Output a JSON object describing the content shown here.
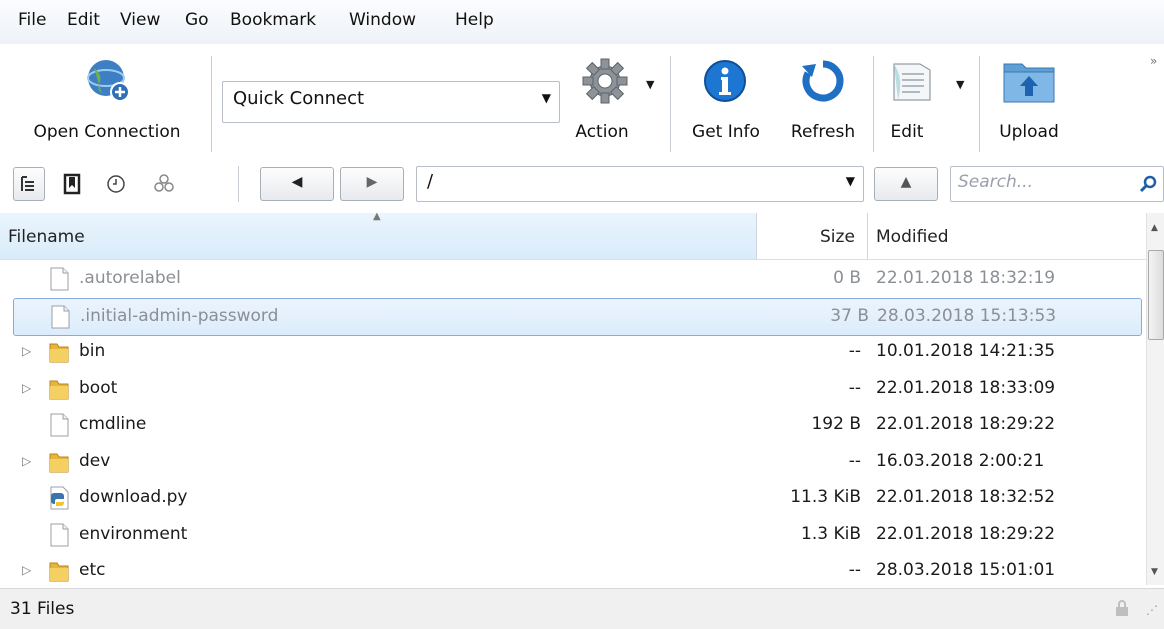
{
  "menu": [
    "File",
    "Edit",
    "View",
    "Go",
    "Bookmark",
    "Window",
    "Help"
  ],
  "toolbar": {
    "open_connection": "Open Connection",
    "quick_connect": "Quick Connect",
    "action": "Action",
    "get_info": "Get Info",
    "refresh": "Refresh",
    "edit": "Edit",
    "upload": "Upload"
  },
  "nav": {
    "path": "/",
    "search_placeholder": "Search..."
  },
  "table": {
    "columns": {
      "filename": "Filename",
      "size": "Size",
      "modified": "Modified"
    },
    "rows": [
      {
        "name": ".autorelabel",
        "size": "0 B",
        "modified": "22.01.2018 18:32:19",
        "type": "file"
      },
      {
        "name": ".initial-admin-password",
        "size": "37 B",
        "modified": "28.03.2018 15:13:53",
        "type": "file"
      },
      {
        "name": "bin",
        "size": "--",
        "modified": "10.01.2018 14:21:35",
        "type": "folder"
      },
      {
        "name": "boot",
        "size": "--",
        "modified": "22.01.2018 18:33:09",
        "type": "folder"
      },
      {
        "name": "cmdline",
        "size": "192 B",
        "modified": "22.01.2018 18:29:22",
        "type": "file"
      },
      {
        "name": "dev",
        "size": "--",
        "modified": "16.03.2018 2:00:21",
        "type": "folder"
      },
      {
        "name": "download.py",
        "size": "11.3 KiB",
        "modified": "22.01.2018 18:32:52",
        "type": "python"
      },
      {
        "name": "environment",
        "size": "1.3 KiB",
        "modified": "22.01.2018 18:29:22",
        "type": "file"
      },
      {
        "name": "etc",
        "size": "--",
        "modified": "28.03.2018 15:01:01",
        "type": "folder"
      }
    ]
  },
  "status": {
    "text": "31 Files"
  },
  "colors": {
    "selection": "#dcecfc",
    "selection_border": "#84acdd",
    "header": "#d9ecfa"
  }
}
